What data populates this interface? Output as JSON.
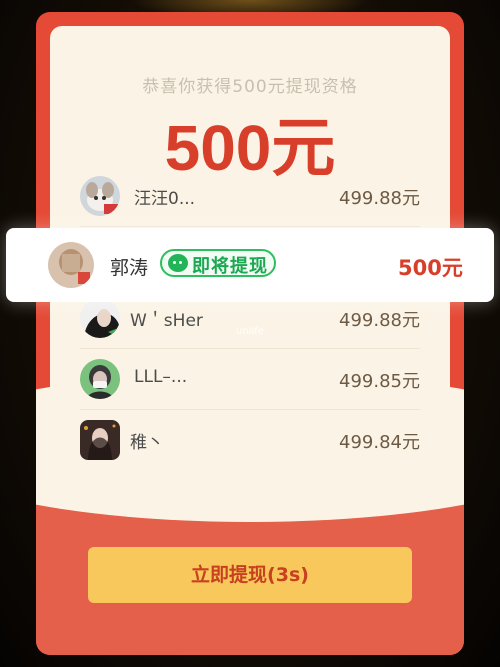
{
  "header": {
    "subtitle": "恭喜你获得500元提现资格",
    "amount": "500元"
  },
  "winners": [
    {
      "name": "汪汪0...",
      "amount": "499.88元",
      "avatar": "avatar-dog"
    },
    {
      "name": "W＇sHer",
      "amount": "499.88元",
      "avatar": "avatar-girl-dark"
    },
    {
      "name": "LLL–...",
      "amount": "499.85元",
      "avatar": "avatar-masked"
    },
    {
      "name": "稚丶",
      "amount": "499.84元",
      "avatar": "avatar-girl-portrait"
    }
  ],
  "current_user": {
    "name": "郭涛",
    "badge": "即将提现",
    "amount": "500元",
    "badge_icon": "wechat-icon"
  },
  "cta": {
    "label": "立即提现(3s)"
  },
  "watermark": "unlife",
  "colors": {
    "card_red": "#e44a36",
    "paper": "#fbf4e6",
    "accent_red": "#d83f2a",
    "cta_yellow": "#f8c85c",
    "wechat_green": "#22b457"
  }
}
